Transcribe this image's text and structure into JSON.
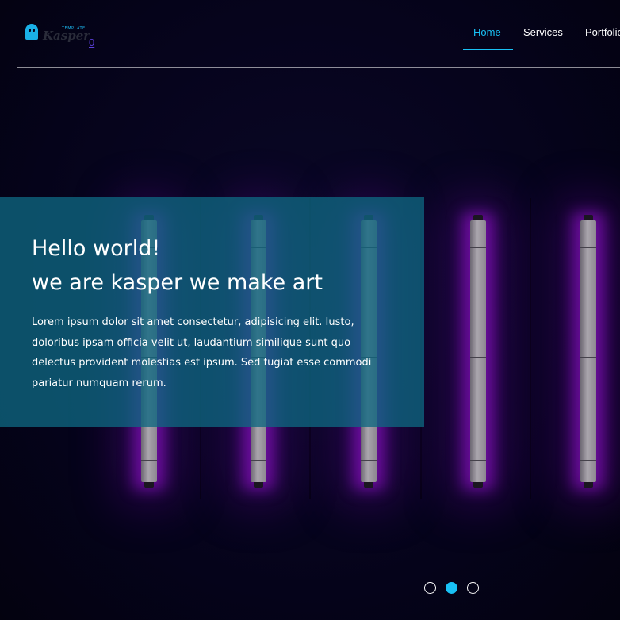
{
  "logo": {
    "icon": "ghost-icon",
    "tagline": "TEMPLATE",
    "name": "Kasper"
  },
  "cart": {
    "count": "0"
  },
  "nav": {
    "items": [
      {
        "label": "Home",
        "active": true
      },
      {
        "label": "Services",
        "active": false
      },
      {
        "label": "Portfolio",
        "active": false
      }
    ],
    "active_color": "#19c1f5"
  },
  "hero": {
    "title": "Hello world!",
    "subtitle": "we are kasper we make art",
    "text": "Lorem ipsum dolor sit amet consectetur, adipisicing elit. Iusto, doloribus ipsam officia velit ut, laudantium similique sunt quo delectus provident molestias est ipsum. Sed fugiat esse commodi pariatur numquam rerum.",
    "panel_color": "#0e6680"
  },
  "slider": {
    "count": 3,
    "active_index": 1
  }
}
